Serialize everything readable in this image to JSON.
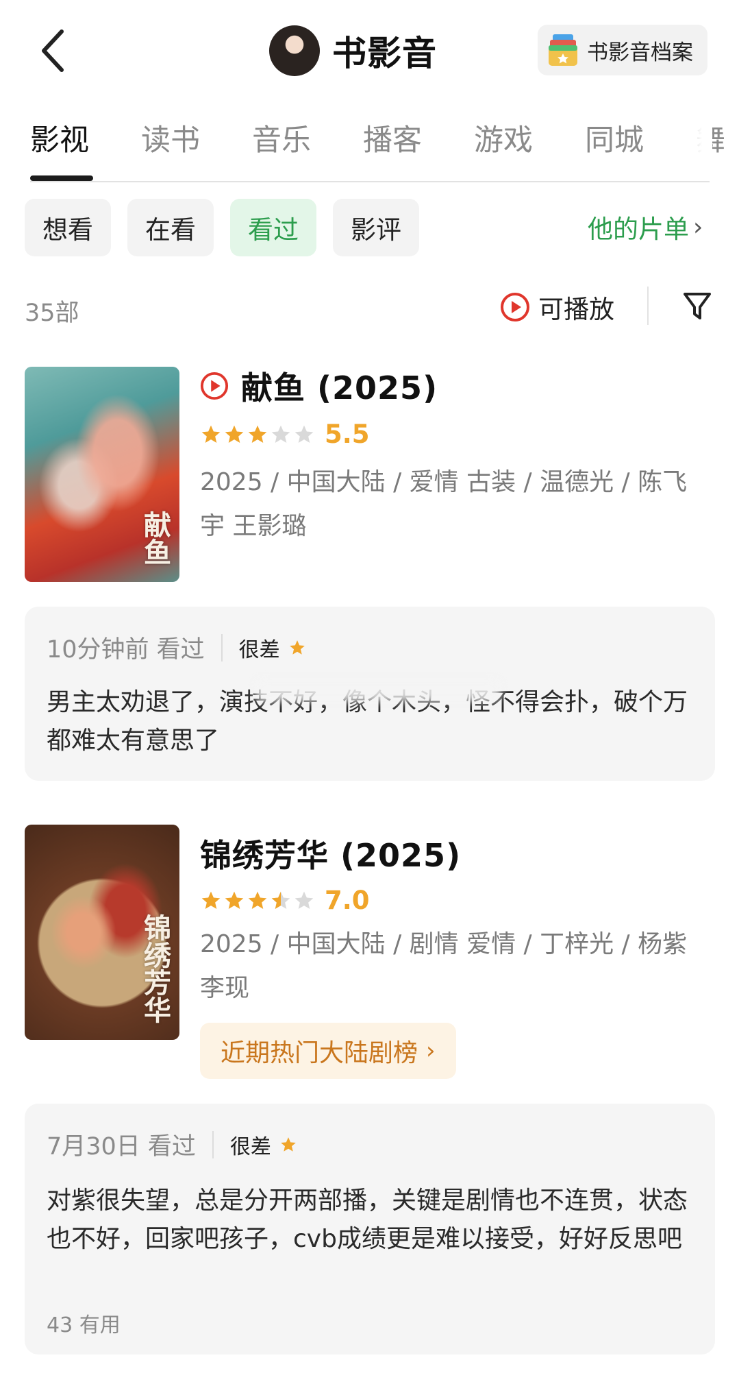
{
  "header": {
    "title": "书影音",
    "archive_label": "书影音档案"
  },
  "tabs": [
    {
      "label": "影视",
      "active": true
    },
    {
      "label": "读书"
    },
    {
      "label": "音乐"
    },
    {
      "label": "播客"
    },
    {
      "label": "游戏"
    },
    {
      "label": "同城"
    },
    {
      "label": "舞"
    }
  ],
  "filters": {
    "chips": [
      "想看",
      "在看",
      "看过",
      "影评"
    ],
    "active": "看过",
    "list_link": "他的片单"
  },
  "summary": {
    "count": "35部",
    "playable_label": "可播放"
  },
  "colors": {
    "accent_green": "#2c9d4d",
    "star_gold": "#f0a52a",
    "play_red": "#e0362c"
  },
  "movies": [
    {
      "title": "献鱼 (2025)",
      "rating": 5.5,
      "rating_text": "5.5",
      "stars_filled": 3,
      "stars_half": 0,
      "playable": true,
      "meta": "2025 / 中国大陆 / 爱情 古装 / 温德光 / 陈飞宇 王影璐",
      "poster_caption": "献鱼",
      "review": {
        "time": "10分钟前 看过",
        "grade": "很差",
        "text": "男主太劝退了，演技不好，像个木头，怪不得会扑，破个万都难太有意思了"
      }
    },
    {
      "title": "锦绣芳华 (2025)",
      "rating": 7.0,
      "rating_text": "7.0",
      "stars_filled": 3,
      "stars_half": 1,
      "playable": false,
      "meta": "2025 / 中国大陆 / 剧情 爱情 / 丁梓光 / 杨紫 李现",
      "poster_caption": "锦绣芳华",
      "hot_tag": "近期热门大陆剧榜",
      "review": {
        "time": "7月30日 看过",
        "grade": "很差",
        "text": "对紫很失望，总是分开两部播，关键是剧情也不连贯，状态也不好，回家吧孩子，cvb成绩更是难以接受，好好反思吧",
        "useful": "43 有用"
      }
    }
  ]
}
